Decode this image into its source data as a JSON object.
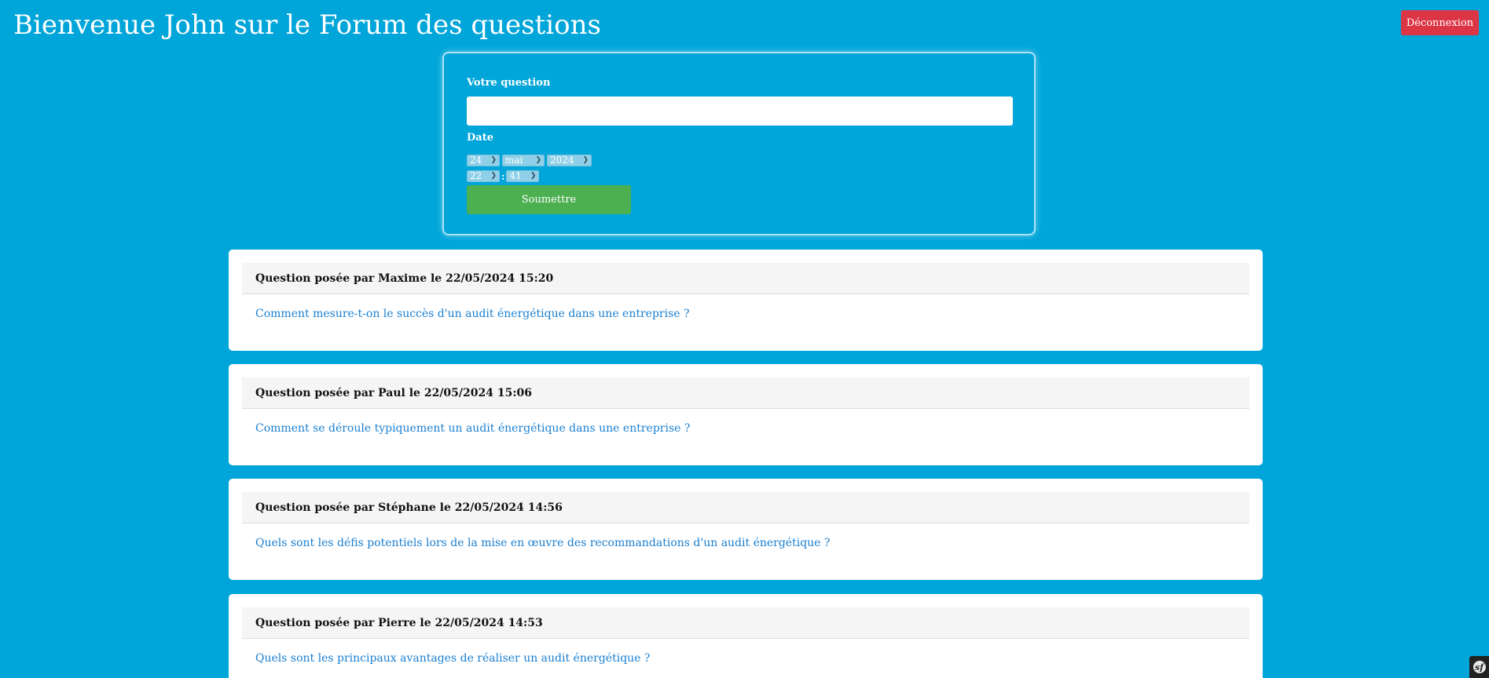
{
  "header": {
    "title": "Bienvenue John sur le Forum des questions",
    "logout_label": "Déconnexion"
  },
  "form": {
    "question_label": "Votre question",
    "question_value": "",
    "date_label": "Date",
    "day": "24",
    "month": "mai",
    "year": "2024",
    "hour": "22",
    "time_separator": ":",
    "minute": "41",
    "submit_label": "Soumettre"
  },
  "questions": [
    {
      "header": "Question posée par Maxime le 22/05/2024 15:20",
      "text": "Comment mesure-t-on le succès d'un audit énergétique dans une entreprise ?"
    },
    {
      "header": "Question posée par Paul le 22/05/2024 15:06",
      "text": "Comment se déroule typiquement un audit énergétique dans une entreprise ?"
    },
    {
      "header": "Question posée par Stéphane le 22/05/2024 14:56",
      "text": "Quels sont les défis potentiels lors de la mise en œuvre des recommandations d'un audit énergétique ?"
    },
    {
      "header": "Question posée par Pierre le 22/05/2024 14:53",
      "text": "Quels sont les principaux avantages de réaliser un audit énergétique ?"
    }
  ],
  "colors": {
    "background": "#00a5d9",
    "logout": "#dc3545",
    "submit": "#4caf50",
    "link": "#1a7fd0"
  },
  "icons": {
    "chevron": "chevron-down-icon",
    "symfony": "symfony-logo-icon"
  }
}
